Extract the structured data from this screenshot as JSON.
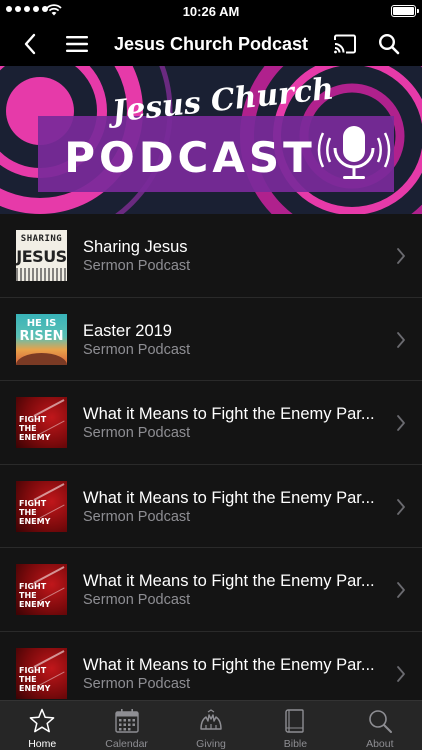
{
  "status_bar": {
    "time": "10:26 AM"
  },
  "nav": {
    "title": "Jesus Church Podcast",
    "icons": {
      "back": "chevron-left-icon",
      "menu": "hamburger-menu-icon",
      "cast": "cast-icon",
      "search": "search-icon"
    }
  },
  "banner": {
    "script_text": "Jesus Church",
    "main_text": "PODCAST",
    "colors": {
      "background": "#1a2033",
      "accent": "#e63aa9",
      "strip": "#7a2a9a"
    }
  },
  "episodes": [
    {
      "title": "Sharing Jesus",
      "subtitle": "Sermon Podcast",
      "artwork": {
        "line1": "SHARING",
        "line2": "JESUS"
      }
    },
    {
      "title": "Easter 2019",
      "subtitle": "Sermon Podcast",
      "artwork": {
        "line1": "HE IS",
        "line2": "RISEN"
      }
    },
    {
      "title": "What it Means to Fight the Enemy Par...",
      "subtitle": "Sermon Podcast",
      "artwork": {
        "line1": "FIGHT",
        "line2": "THE ENEMY"
      }
    },
    {
      "title": "What it Means to Fight the Enemy Par...",
      "subtitle": "Sermon Podcast",
      "artwork": {
        "line1": "FIGHT",
        "line2": "THE ENEMY"
      }
    },
    {
      "title": "What it Means to Fight the Enemy Par...",
      "subtitle": "Sermon Podcast",
      "artwork": {
        "line1": "FIGHT",
        "line2": "THE ENEMY"
      }
    },
    {
      "title": "What it Means to Fight the Enemy Par...",
      "subtitle": "Sermon Podcast",
      "artwork": {
        "line1": "FIGHT",
        "line2": "THE ENEMY"
      }
    }
  ],
  "tabs": [
    {
      "label": "Home",
      "icon": "star-icon",
      "active": true
    },
    {
      "label": "Calendar",
      "icon": "calendar-icon",
      "active": false
    },
    {
      "label": "Giving",
      "icon": "giving-hands-icon",
      "active": false
    },
    {
      "label": "Bible",
      "icon": "bible-book-icon",
      "active": false
    },
    {
      "label": "About",
      "icon": "about-search-icon",
      "active": false
    }
  ],
  "colors": {
    "list_background": "#141414",
    "subtitle": "#8e8e93",
    "tab_bar": "#262626",
    "nav_bar": "#000000"
  }
}
